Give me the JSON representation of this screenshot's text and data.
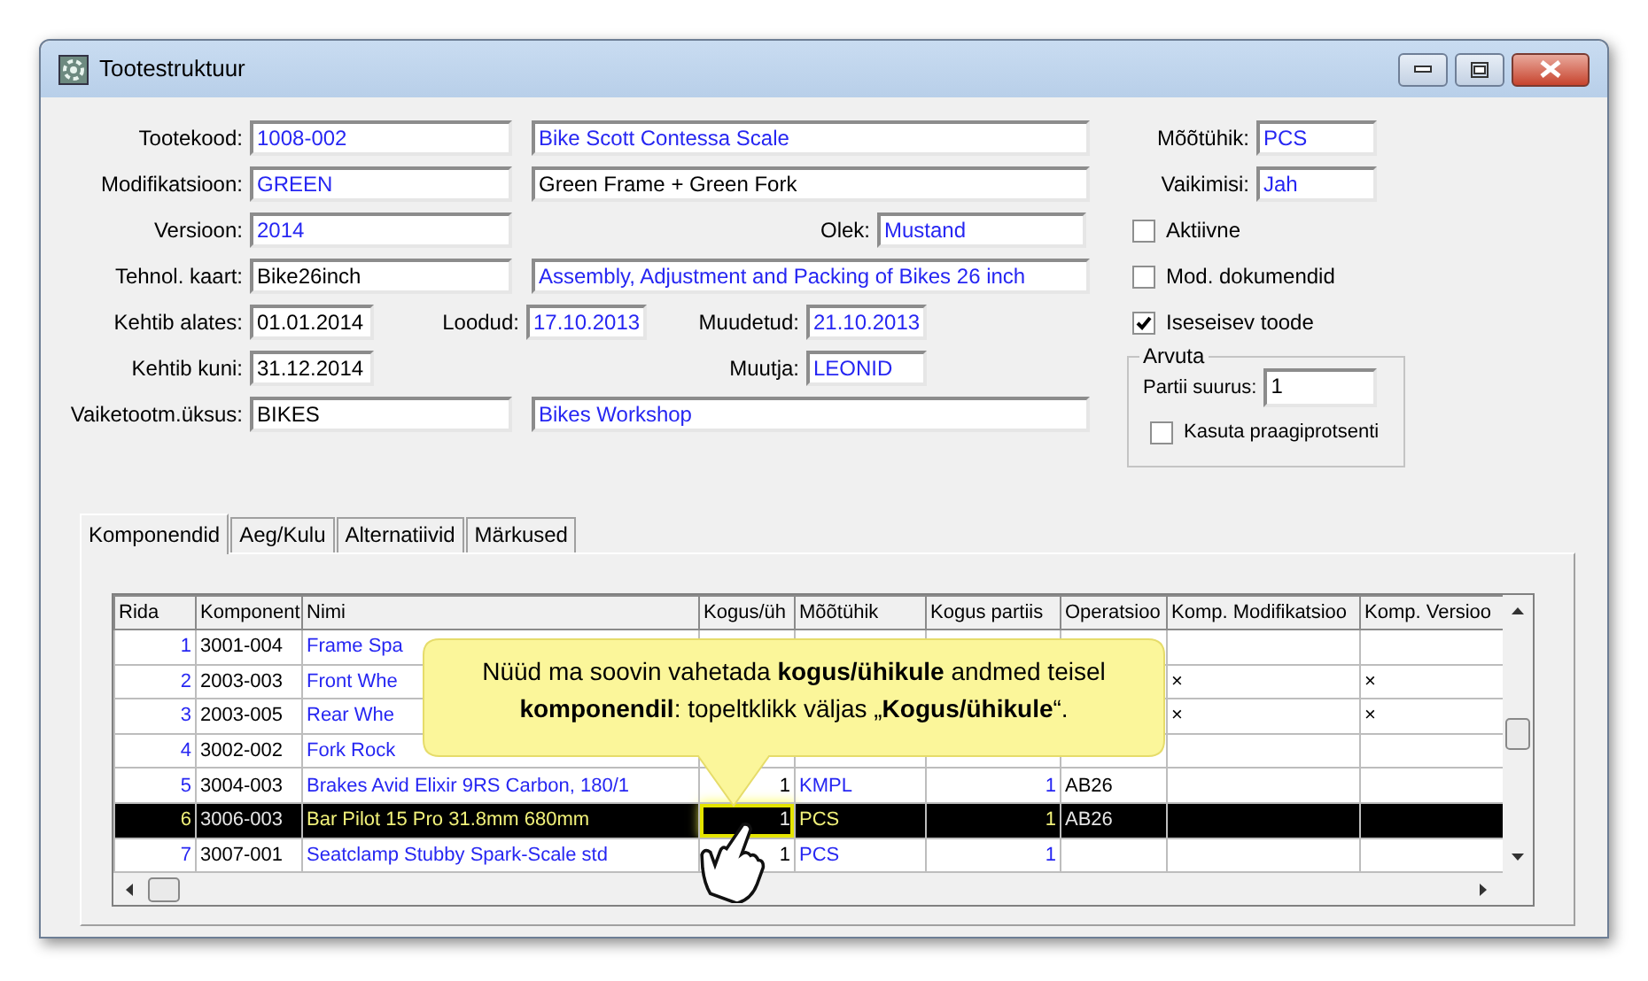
{
  "window": {
    "title": "Tootestruktuur"
  },
  "form": {
    "product_code": {
      "label": "Tootekood:",
      "value": "1008-002",
      "linked": true
    },
    "product_name": {
      "value": "Bike Scott Contessa Scale",
      "linked": true
    },
    "modification": {
      "label": "Modifikatsioon:",
      "value": "GREEN",
      "linked": true
    },
    "modification_name": {
      "value": "Green Frame + Green Fork",
      "linked": false
    },
    "version": {
      "label": "Versioon:",
      "value": "2014",
      "linked": true
    },
    "status": {
      "label": "Olek:",
      "value": "Mustand",
      "linked": true
    },
    "routing": {
      "label": "Tehnol. kaart:",
      "value": "Bike26inch",
      "linked": false
    },
    "routing_name": {
      "value": "Assembly, Adjustment and Packing of Bikes 26 inch",
      "linked": true
    },
    "valid_from": {
      "label": "Kehtib alates:",
      "value": "01.01.2014",
      "linked": false
    },
    "created": {
      "label": "Loodud:",
      "value": "17.10.2013",
      "linked": true
    },
    "modified": {
      "label": "Muudetud:",
      "value": "21.10.2013",
      "linked": true
    },
    "valid_to": {
      "label": "Kehtib kuni:",
      "value": "31.12.2014",
      "linked": false
    },
    "modified_by": {
      "label": "Muutja:",
      "value": "LEONID",
      "linked": true
    },
    "default_unit": {
      "label": "Vaiketootm.üksus:",
      "value": "BIKES",
      "linked": false
    },
    "default_unit_name": {
      "value": "Bikes Workshop",
      "linked": true
    },
    "unit": {
      "label": "Mõõtühik:",
      "value": "PCS",
      "linked": true
    },
    "is_default": {
      "label": "Vaikimisi:",
      "value": "Jah",
      "linked": true
    }
  },
  "checkboxes": [
    {
      "label": "Aktiivne",
      "checked": false
    },
    {
      "label": "Mod. dokumendid",
      "checked": false
    },
    {
      "label": "Iseseisev toode",
      "checked": true
    }
  ],
  "calculate": {
    "title": "Arvuta",
    "batch_size": {
      "label": "Partii suurus:",
      "value": "1"
    },
    "use_scrap": {
      "label": "Kasuta praagiprotsenti",
      "checked": false
    }
  },
  "tabs": [
    {
      "label": "Komponendid",
      "selected": true
    },
    {
      "label": "Aeg/Kulu",
      "selected": false
    },
    {
      "label": "Alternatiivid",
      "selected": false
    },
    {
      "label": "Märkused",
      "selected": false
    }
  ],
  "table": {
    "columns": [
      {
        "label": "Rida",
        "kind": "number",
        "linked": true
      },
      {
        "label": "Komponent",
        "kind": "text",
        "linked": false
      },
      {
        "label": "Nimi",
        "kind": "text",
        "linked": true
      },
      {
        "label": "Kogus/üh",
        "kind": "number",
        "linked": false
      },
      {
        "label": "Mõõtühik",
        "kind": "text",
        "linked": true
      },
      {
        "label": "Kogus partiis",
        "kind": "number",
        "linked": true
      },
      {
        "label": "Operatsioo",
        "kind": "text",
        "linked": false
      },
      {
        "label": "Komp. Modifikatsioo",
        "kind": "text",
        "linked": false
      },
      {
        "label": "Komp. Versioo",
        "kind": "text",
        "linked": false
      }
    ],
    "rows": [
      {
        "cells": [
          "1",
          "3001-004",
          "Frame Spa",
          null,
          null,
          null,
          null,
          null,
          null
        ],
        "selected": false
      },
      {
        "cells": [
          "2",
          "2003-003",
          "Front Whe",
          null,
          null,
          null,
          null,
          "×",
          "×"
        ],
        "selected": false
      },
      {
        "cells": [
          "3",
          "2003-005",
          "Rear Whe",
          null,
          null,
          null,
          null,
          "×",
          "×"
        ],
        "selected": false
      },
      {
        "cells": [
          "4",
          "3002-002",
          "Fork Rock",
          null,
          null,
          null,
          null,
          null,
          null
        ],
        "selected": false
      },
      {
        "cells": [
          "5",
          "3004-003",
          "Brakes Avid Elixir 9RS Carbon, 180/1",
          "1",
          "KMPL",
          "1",
          "AB26",
          null,
          null
        ],
        "selected": false,
        "quantity_focused": false
      },
      {
        "cells": [
          "6",
          "3006-003",
          "Bar Pilot 15 Pro 31.8mm 680mm",
          "1",
          "PCS",
          "1",
          "AB26",
          null,
          null
        ],
        "selected": true,
        "quantity_focused": true
      },
      {
        "cells": [
          "7",
          "3007-001",
          "Seatclamp Stubby Spark-Scale std",
          "1",
          "PCS",
          "1",
          null,
          null,
          null
        ],
        "selected": false,
        "quantity_focused": false
      }
    ]
  },
  "callout": {
    "text": "Nüüd ma soovin vahetada **kogus/ühikule** andmed teisel **komponendil**: topeltklikk väljas „**Kogus/ühikule**“."
  }
}
